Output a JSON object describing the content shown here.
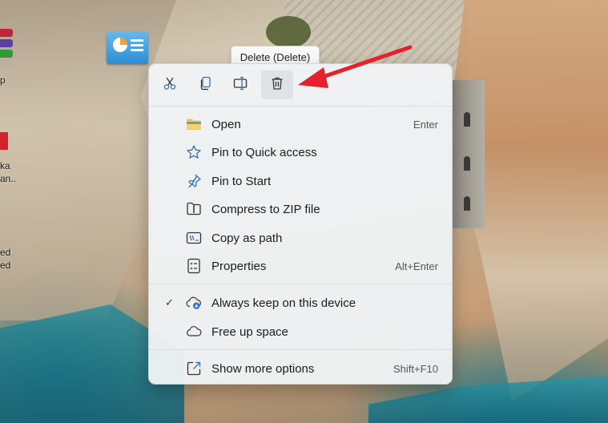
{
  "desktop": {
    "edge_labels": [
      "p",
      "ka\nan..",
      "ed\ned"
    ],
    "shortcut_icon": "control-panel-icon"
  },
  "tooltip": {
    "text": "Delete (Delete)"
  },
  "toolbar": {
    "cut_icon": "scissors-icon",
    "copy_icon": "copy-icon",
    "rename_icon": "rename-icon",
    "delete_icon": "trash-icon"
  },
  "menu": {
    "items": [
      {
        "label": "Open",
        "shortcut": "Enter",
        "icon": "folder-icon"
      },
      {
        "label": "Pin to Quick access",
        "shortcut": "",
        "icon": "star-icon"
      },
      {
        "label": "Pin to Start",
        "shortcut": "",
        "icon": "pin-icon"
      },
      {
        "label": "Compress to ZIP file",
        "shortcut": "",
        "icon": "zip-icon"
      },
      {
        "label": "Copy as path",
        "shortcut": "",
        "icon": "path-icon"
      },
      {
        "label": "Properties",
        "shortcut": "Alt+Enter",
        "icon": "properties-icon"
      },
      {
        "label": "Always keep on this device",
        "shortcut": "",
        "icon": "cloud-download-icon",
        "checked": "✓"
      },
      {
        "label": "Free up space",
        "shortcut": "",
        "icon": "cloud-icon"
      },
      {
        "label": "Show more options",
        "shortcut": "Shift+F10",
        "icon": "expand-icon"
      }
    ]
  },
  "colors": {
    "annotation_arrow": "#e5212b",
    "folder_yellow": "#f6c243",
    "accent_blue": "#2f6fd6"
  }
}
